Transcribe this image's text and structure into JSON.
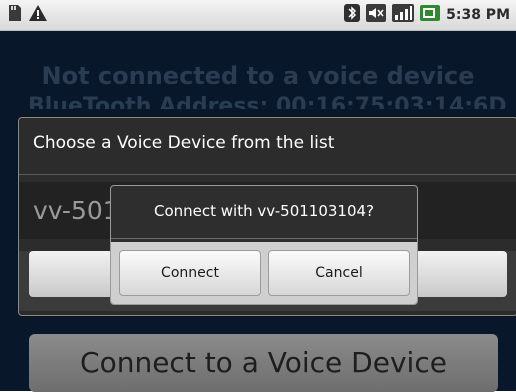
{
  "status_bar": {
    "time": "5:38 PM",
    "left_icons": [
      "sd-card-icon",
      "warning-icon"
    ],
    "right_icons": [
      "bluetooth-icon",
      "volume-muted-icon",
      "signal-icon",
      "battery-icon"
    ]
  },
  "app": {
    "status_text": "Not connected to a voice device",
    "address_text": "BlueTooth Address: 00:16:75:03:14:6D",
    "main_button_label": "Connect to a Voice Device"
  },
  "device_dialog": {
    "title": "Choose a Voice Device from the list",
    "devices": [
      "vv-501103104"
    ]
  },
  "confirm_dialog": {
    "title": "Connect with vv-501103104?",
    "connect_label": "Connect",
    "cancel_label": "Cancel"
  },
  "colors": {
    "app_background": "#08182a",
    "dialog_background": "#2c2c2c",
    "status_bar": "#e6e6e6"
  }
}
